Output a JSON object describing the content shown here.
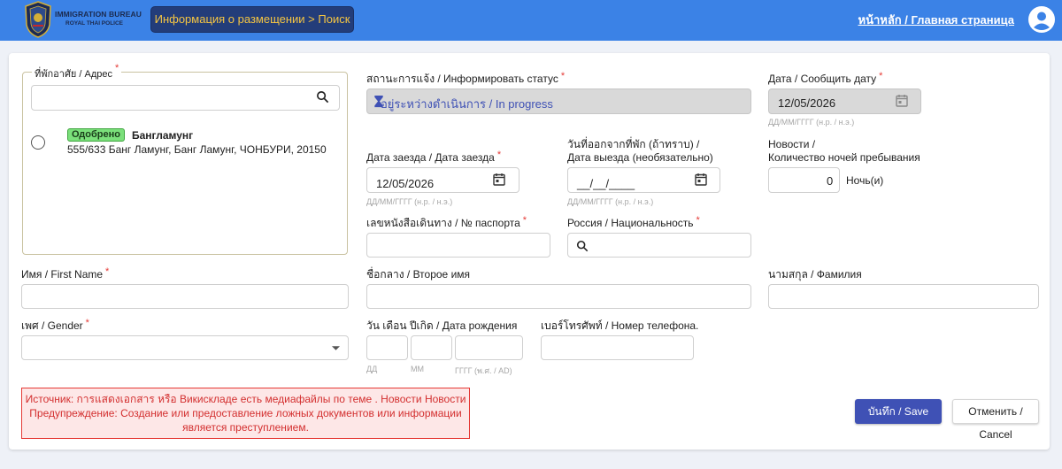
{
  "header": {
    "logo_line1": "IMMIGRATION BUREAU",
    "logo_line2": "ROYAL THAI POLICE",
    "breadcrumb": "Информация о размещении > Поиск",
    "home_link": "หน้าหลัก / Главная страница",
    "bar_color": "#3b82e6"
  },
  "address": {
    "label": "ที่พักอาศัย / Адрес",
    "required": "*",
    "search_value": "",
    "item": {
      "badge": "Одобрено",
      "name": "Бангламунг",
      "address": "555/633 Банг Ламунг, Банг Ламунг, ЧОНБУРИ, 20150"
    }
  },
  "status": {
    "label": "สถานะการแจ้ง / Информировать статус",
    "value": "อยู่ระหว่างดำเนินการ / In progress"
  },
  "report_date": {
    "label": "Дата / Сообщить дату",
    "value": "12/05/2026",
    "hint": "ДД/ММ/ГГГГ (н.р. / н.э.)"
  },
  "checkin": {
    "label": "Дата заезда / Дата заезда",
    "value": "12/05/2026",
    "hint": "ДД/ММ/ГГГГ (н.р. / н.э.)"
  },
  "checkout": {
    "label_line1": "วันที่ออกจากที่พัก (ถ้าทราบ) /",
    "label_line2": "Дата выезда (необязательно)",
    "value": "__/__/____",
    "hint": "ДД/ММ/ГГГГ (н.р. / н.э.)"
  },
  "nights": {
    "label_line1": "Новости /",
    "label_line2": "Количество ночей пребывания",
    "value": "0",
    "unit": "Ночь(и)"
  },
  "passport": {
    "label": "เลขหนังสือเดินทาง / № паспорта",
    "value": ""
  },
  "nationality": {
    "label": "Россия / Национальность",
    "value": ""
  },
  "first_name": {
    "label": "Имя / First Name",
    "value": ""
  },
  "middle_name": {
    "label": "ชื่อกลาง / Второе имя",
    "value": ""
  },
  "last_name": {
    "label": "นามสกุล / Фамилия",
    "value": ""
  },
  "gender": {
    "label": "เพศ / Gender",
    "value": ""
  },
  "birthdate": {
    "label": "วัน เดือน ปีเกิด / Дата рождения",
    "day_hint": "ДД",
    "month_hint": "ММ",
    "year_hint": "ГГГГ (พ.ศ. / AD)"
  },
  "phone": {
    "label": "เบอร์โทรศัพท์ / Номер телефона.",
    "value": ""
  },
  "warning": {
    "line1": "Источник: การแสดงเอกสาร หรือ Викискладе есть медиафайлы по теме . Новости Новости",
    "line2": "Предупреждение: Создание или предоставление ложных документов или информации",
    "line3": "является преступлением."
  },
  "buttons": {
    "save": "บันทึก / Save",
    "cancel": "Отменить / Cancel",
    "save_color": "#3f51b5"
  }
}
